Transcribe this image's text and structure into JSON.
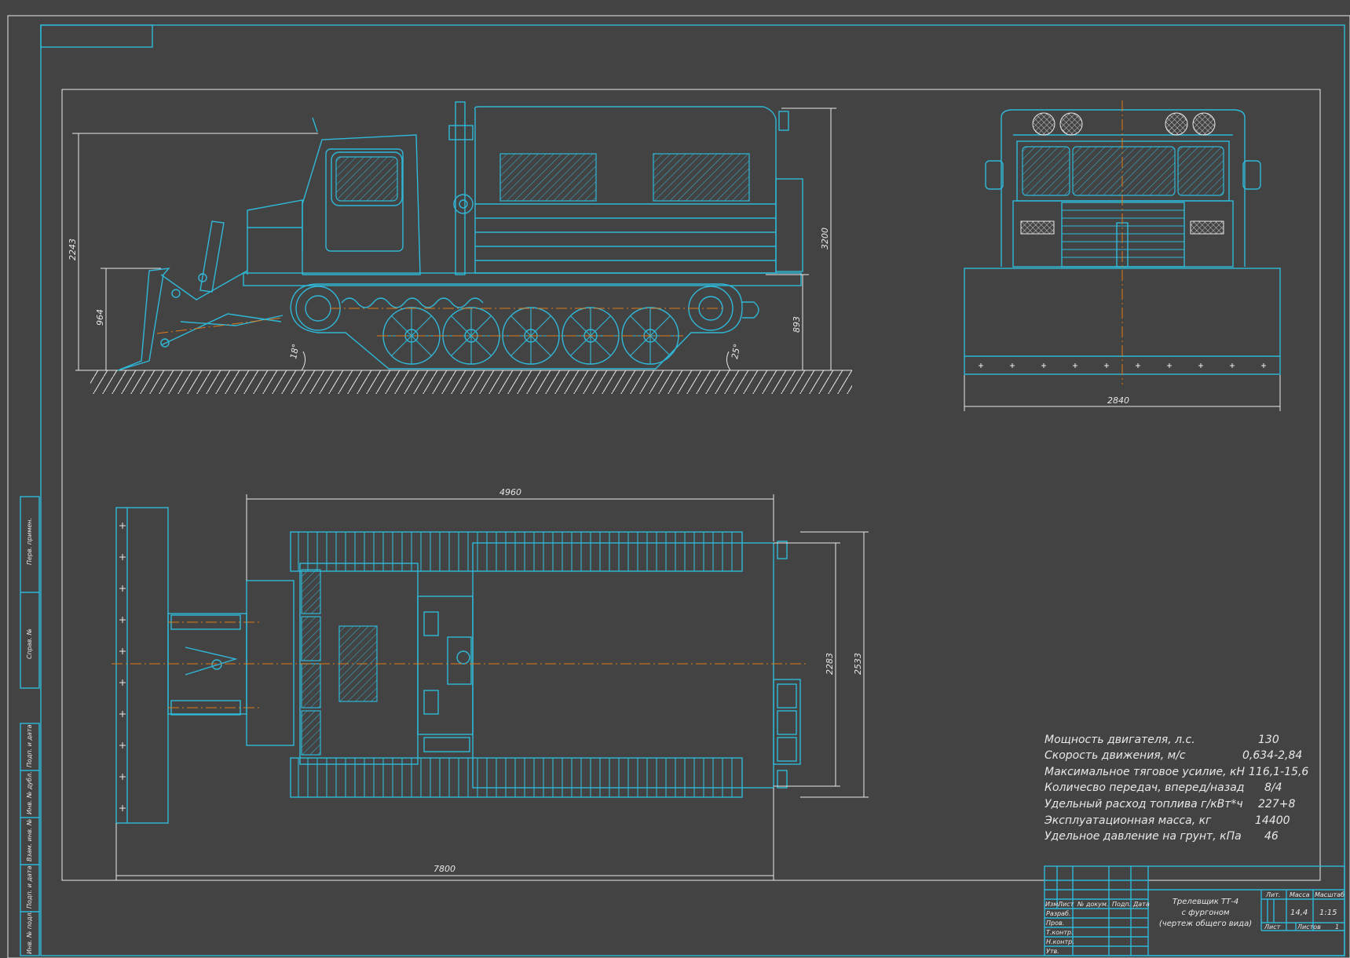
{
  "dimensions": {
    "d2243": "2243",
    "d964": "964",
    "d3200": "3200",
    "d893": "893",
    "d2840": "2840",
    "d4960": "4960",
    "d7800": "7800",
    "d2283": "2283",
    "d2533": "2533",
    "a18": "18°",
    "a25": "25°"
  },
  "specs": [
    {
      "label": "Мощность двигателя, л.с.",
      "value": "130"
    },
    {
      "label": "Скорость движения, м/с",
      "value": "0,634-2,84"
    },
    {
      "label": "Максимальное тяговое усилие, кН",
      "value": "116,1-15,6"
    },
    {
      "label": "Количесво передач, вперед/назад",
      "value": "8/4"
    },
    {
      "label": "Удельный расход топлива г/кВт*ч",
      "value": "227+8"
    },
    {
      "label": "Эксплуатационная масса, кг",
      "value": "14400"
    },
    {
      "label": "Удельное давление на грунт, кПа",
      "value": "46"
    }
  ],
  "title_block": {
    "title_line1": "Трелевщик ТТ-4",
    "title_line2": "с фургоном",
    "title_line3": "(чертеж общего вида)",
    "col_izm": "Изм.",
    "col_list": "Лист",
    "col_ndoc": "№ докум.",
    "col_podp": "Подп.",
    "col_data": "Дата",
    "row_razrab": "Разраб.",
    "row_prov": "Пров.",
    "row_tkontr": "Т.контр.",
    "row_nkontr": "Н.контр.",
    "row_utv": "Утв.",
    "lit": "Лит.",
    "massa": "Масса",
    "masshtab": "Масштаб",
    "mass_value": "14,4",
    "scale_value": "1:15",
    "sheet_label": "Лист",
    "sheets_label": "Листов",
    "sheets_value": "1"
  },
  "side_stamp": {
    "perv_primen": "Перв. примен.",
    "sprav": "Справ. №",
    "podp_data_1": "Подп. и дата",
    "inv_dubl": "Инв. № дубл.",
    "vzam_inv": "Взам. инв. №",
    "podp_data_2": "Подп. и дата",
    "inv_podl": "Инв. № подл."
  },
  "colors": {
    "line": "#2fb8d8",
    "background": "#434343",
    "axis": "#e07a1a",
    "text": "#e8e8e8"
  }
}
